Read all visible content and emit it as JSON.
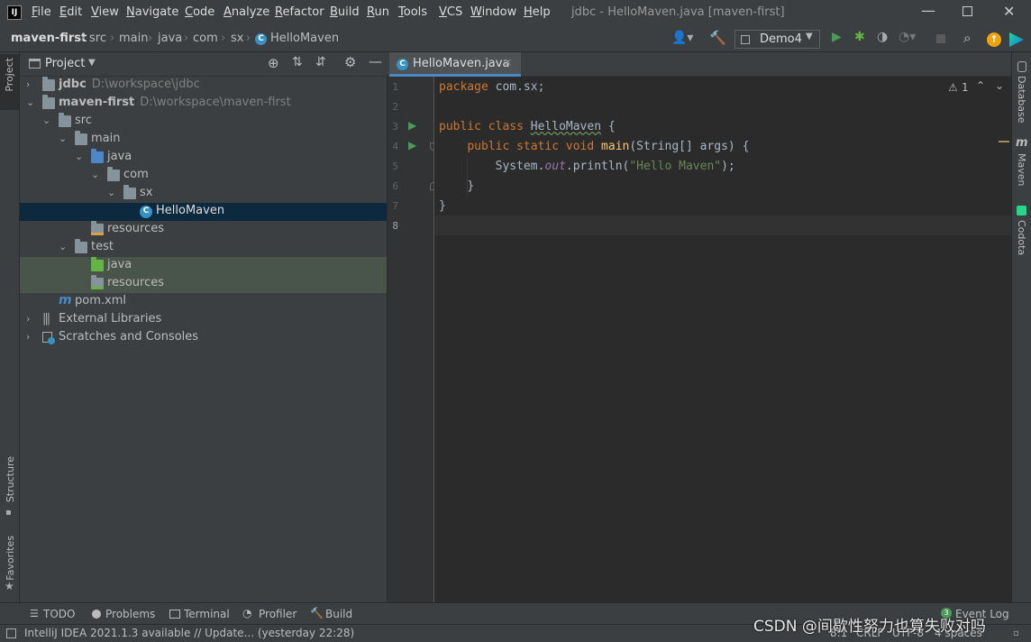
{
  "window": {
    "title": "jdbc - HelloMaven.java [maven-first]"
  },
  "menu": [
    "File",
    "Edit",
    "View",
    "Navigate",
    "Code",
    "Analyze",
    "Refactor",
    "Build",
    "Run",
    "Tools",
    "VCS",
    "Window",
    "Help"
  ],
  "breadcrumb": [
    "maven-first",
    "src",
    "main",
    "java",
    "com",
    "sx",
    "HelloMaven"
  ],
  "toolbar": {
    "run_config": "Demo4"
  },
  "left_strip": {
    "project": "Project",
    "structure": "Structure",
    "favorites": "Favorites"
  },
  "right_strip": {
    "database": "Database",
    "maven": "Maven",
    "codota": "Codota"
  },
  "project_panel": {
    "title": "Project"
  },
  "tree": [
    {
      "label": "jdbc",
      "hint": "D:\\workspace\\jdbc",
      "bold": true
    },
    {
      "label": "maven-first",
      "hint": "D:\\workspace\\maven-first",
      "bold": true
    },
    {
      "label": "src"
    },
    {
      "label": "main"
    },
    {
      "label": "java"
    },
    {
      "label": "com"
    },
    {
      "label": "sx"
    },
    {
      "label": "HelloMaven"
    },
    {
      "label": "resources"
    },
    {
      "label": "test"
    },
    {
      "label": "java"
    },
    {
      "label": "resources"
    },
    {
      "label": "pom.xml"
    },
    {
      "label": "External Libraries"
    },
    {
      "label": "Scratches and Consoles"
    }
  ],
  "editor": {
    "tab_label": "HelloMaven.java",
    "warning_count": "1",
    "line_numbers": [
      "1",
      "2",
      "3",
      "4",
      "5",
      "6",
      "7",
      "8"
    ],
    "lines": [
      {
        "kw1": "package",
        "rest": " com.sx;"
      },
      {},
      {
        "kw1": "public",
        "kw2": "class",
        "cls": "HelloMaven",
        "rest": " {"
      },
      {
        "kw1": "public",
        "kw2": "static",
        "kw3": "void",
        "fn": "main",
        "rest": "(String[] args) {"
      },
      {
        "pre": "System.",
        "fld": "out",
        "mid": ".println(",
        "str": "\"Hello Maven\"",
        "rest": ");"
      },
      {
        "rest": "}"
      },
      {
        "rest": "}"
      },
      {}
    ]
  },
  "bottom_tools": [
    "TODO",
    "Problems",
    "Terminal",
    "Profiler",
    "Build"
  ],
  "event_log": {
    "label": "Event Log",
    "count": "3"
  },
  "status": {
    "message": "IntelliJ IDEA 2021.1.3 available // Update... (yesterday 22:28)",
    "position": "8:1",
    "line_sep": "CRLF",
    "encoding": "UTF-8",
    "indent": "4 spaces"
  },
  "watermark": "CSDN @间歇性努力也算失败对吗"
}
